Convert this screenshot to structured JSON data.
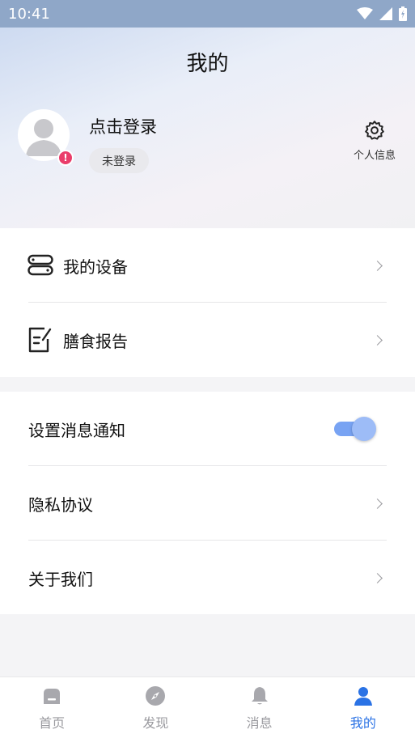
{
  "status_bar": {
    "time": "10:41"
  },
  "header": {
    "title": "我的"
  },
  "profile": {
    "login_prompt": "点击登录",
    "login_status": "未登录",
    "badge": "!",
    "settings_label": "个人信息"
  },
  "menu_group_1": {
    "items": [
      {
        "label": "我的设备",
        "icon": "device-icon"
      },
      {
        "label": "膳食报告",
        "icon": "report-icon"
      }
    ]
  },
  "menu_group_2": {
    "items": [
      {
        "label": "设置消息通知",
        "toggle_on": true
      },
      {
        "label": "隐私协议"
      },
      {
        "label": "关于我们"
      }
    ]
  },
  "tabbar": {
    "tabs": [
      {
        "label": "首页",
        "icon": "home-icon",
        "active": false
      },
      {
        "label": "发现",
        "icon": "compass-icon",
        "active": false
      },
      {
        "label": "消息",
        "icon": "bell-icon",
        "active": false
      },
      {
        "label": "我的",
        "icon": "user-icon",
        "active": true
      }
    ]
  },
  "colors": {
    "accent": "#2a72e5",
    "toggle_track": "#78a3f3",
    "badge": "#ea3d6a",
    "inactive_tab": "#9a9a9f"
  }
}
